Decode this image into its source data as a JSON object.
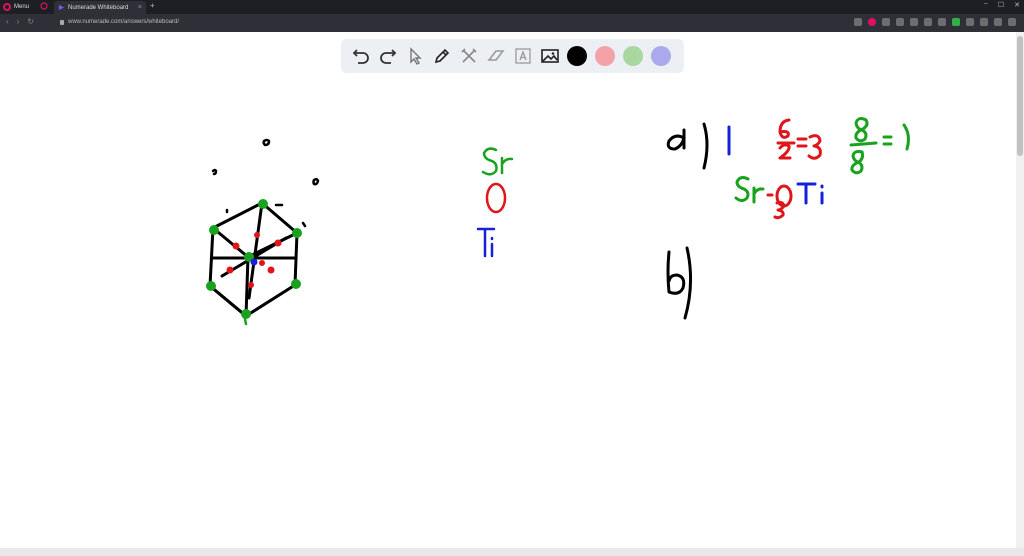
{
  "browser": {
    "menu_label": "Menu",
    "tab_title": "Numerade Whiteboard",
    "tab_close": "×",
    "new_tab": "+",
    "url": "www.numerade.com/answers/whiteboard/",
    "nav": [
      "‹",
      "›",
      "↻"
    ],
    "window_controls": [
      "−",
      "☐",
      "✕"
    ]
  },
  "toolbar": {
    "tools": [
      "undo-icon",
      "redo-icon",
      "pointer-icon",
      "pen-icon",
      "tools-icon",
      "eraser-icon",
      "text-icon",
      "image-icon"
    ],
    "colors": [
      "#000000",
      "#f3a3a8",
      "#a8d8a0",
      "#a9a9ec"
    ]
  },
  "whiteboard": {
    "ink_colors": {
      "black": "#000000",
      "green": "#19a21e",
      "red": "#e0151b",
      "blue": "#1421d8"
    }
  }
}
